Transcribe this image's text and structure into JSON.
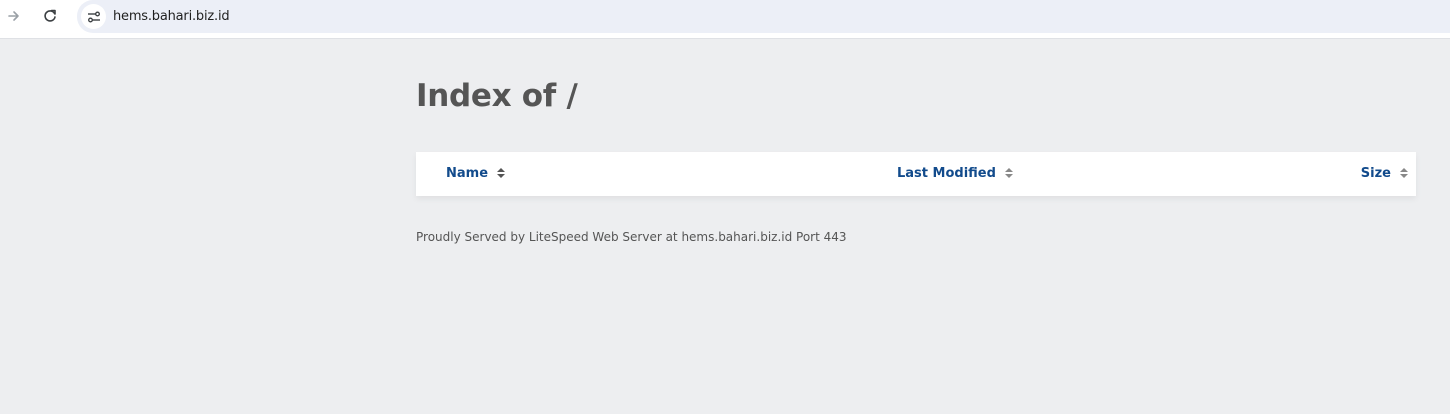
{
  "browser": {
    "url": "hems.bahari.biz.id"
  },
  "page": {
    "title": "Index of /",
    "columns": [
      {
        "label": "Name"
      },
      {
        "label": "Last Modified"
      },
      {
        "label": "Size"
      }
    ],
    "footer": "Proudly Served by LiteSpeed Web Server at hems.bahari.biz.id Port 443"
  },
  "colors": {
    "header_link": "#124b8c",
    "title": "#555555",
    "background": "#edeef0"
  }
}
